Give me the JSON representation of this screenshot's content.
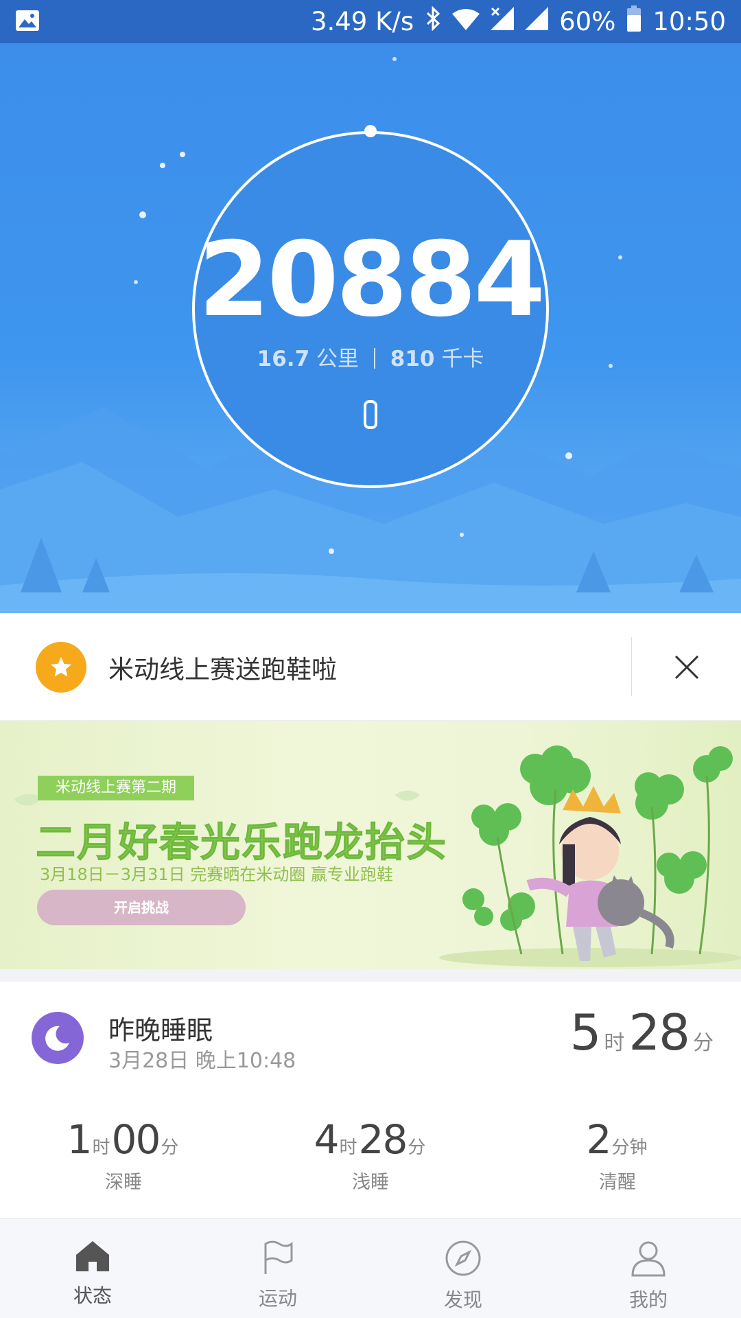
{
  "status_bar": {
    "speed": "3.49 K/s",
    "battery": "60%",
    "time": "10:50"
  },
  "hero": {
    "steps": "20884",
    "distance_value": "16.7",
    "distance_unit": "公里",
    "calories_value": "810",
    "calories_unit": "千卡"
  },
  "promo": {
    "text": "米动线上赛送跑鞋啦"
  },
  "banner": {
    "tag": "米动线上赛第二期",
    "title": "二月好春光乐跑龙抬头",
    "date": "3月18日－3月31日 完赛晒在米动圈  赢专业跑鞋",
    "button": "开启挑战"
  },
  "sleep": {
    "title": "昨晚睡眠",
    "date": "3月28日 晚上10:48",
    "total_hours": "5",
    "hour_unit": "时",
    "total_minutes": "28",
    "minute_unit": "分",
    "stats": [
      {
        "h": "1",
        "hu": "时",
        "m": "00",
        "mu": "分",
        "label": "深睡"
      },
      {
        "h": "4",
        "hu": "时",
        "m": "28",
        "mu": "分",
        "label": "浅睡"
      },
      {
        "h": "2",
        "hu": "分钟",
        "label": "清醒"
      }
    ]
  },
  "nav": {
    "items": [
      {
        "label": "状态",
        "icon": "home-icon"
      },
      {
        "label": "运动",
        "icon": "flag-icon"
      },
      {
        "label": "发现",
        "icon": "compass-icon"
      },
      {
        "label": "我的",
        "icon": "person-icon"
      }
    ]
  },
  "colors": {
    "status_bar": "#2a68c4",
    "hero_blue": "#3f96ee",
    "promo_star": "#f6a91b",
    "moon": "#8566d6",
    "banner_green": "#8fd05a"
  }
}
